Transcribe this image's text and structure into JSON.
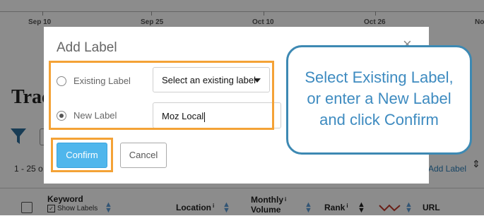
{
  "timeline": {
    "dates": [
      "Sep 10",
      "Sep 25",
      "Oct 10",
      "Oct 26",
      "No"
    ]
  },
  "background": {
    "page_title": "Trac",
    "results_text": "1 - 25 o",
    "add_label_link": "Add Label",
    "columns": {
      "keyword": "Keyword",
      "show_labels": "Show Labels",
      "location": "Location",
      "monthly_line1": "Monthly",
      "monthly_line2": "Volume",
      "rank": "Rank",
      "url": "URL",
      "info_mark": "i"
    }
  },
  "modal": {
    "title": "Add Label",
    "close_glyph": "×",
    "existing_label": "Existing Label",
    "select_value": "Select an existing label",
    "new_label": "New Label",
    "new_label_value": "Moz Local",
    "confirm_label": "Confirm",
    "cancel_label": "Cancel",
    "selected_option": "New Label"
  },
  "callout": {
    "line1": "Select Existing Label,",
    "line2": "or enter a New Label",
    "line3": "and click Confirm"
  },
  "colors": {
    "accent_orange": "#f4a236",
    "confirm_blue": "#4fb6ec",
    "callout_blue": "#3e8bc0",
    "overlay": "rgba(0,0,0,0.45)"
  }
}
